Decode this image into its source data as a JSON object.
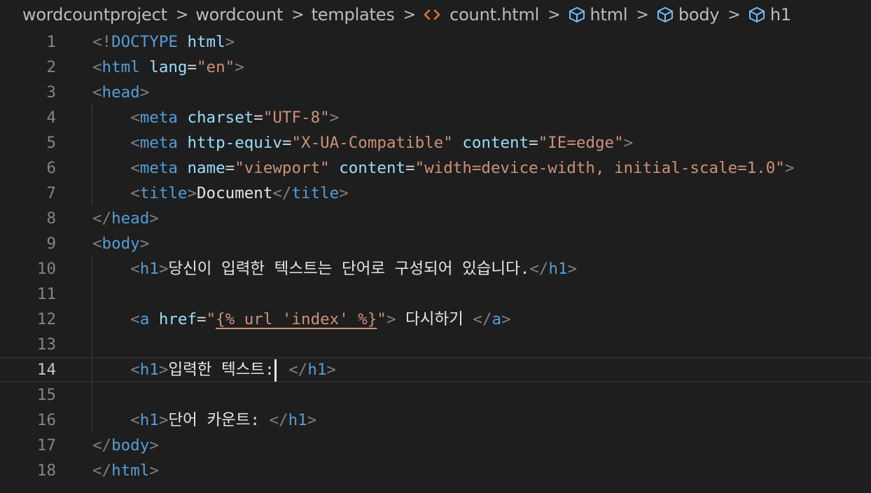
{
  "breadcrumb": {
    "items": [
      {
        "label": "wordcountproject",
        "icon": ""
      },
      {
        "label": "wordcount",
        "icon": ""
      },
      {
        "label": "templates",
        "icon": ""
      },
      {
        "label": "count.html",
        "icon": "html-file-icon"
      },
      {
        "label": "html",
        "icon": "element-cube-icon"
      },
      {
        "label": "body",
        "icon": "element-cube-icon"
      },
      {
        "label": "h1",
        "icon": "element-cube-icon"
      }
    ],
    "separator": ">"
  },
  "editor": {
    "current_line": 14,
    "colors": {
      "background": "#1e1e1e",
      "tag": "#569cd6",
      "attribute": "#9cdcfe",
      "string": "#ce9178",
      "punctuation": "#808080",
      "text": "#e6e6e6",
      "line_number": "#858585"
    },
    "lines": [
      {
        "number": "1",
        "tokens": [
          [
            "punc",
            "<!"
          ],
          [
            "tag",
            "DOCTYPE"
          ],
          [
            "txt",
            " "
          ],
          [
            "attr",
            "html"
          ],
          [
            "punc",
            ">"
          ]
        ]
      },
      {
        "number": "2",
        "tokens": [
          [
            "punc",
            "<"
          ],
          [
            "tag",
            "html"
          ],
          [
            "txt",
            " "
          ],
          [
            "attr",
            "lang"
          ],
          [
            "eq",
            "="
          ],
          [
            "str",
            "\"en\""
          ],
          [
            "punc",
            ">"
          ]
        ]
      },
      {
        "number": "3",
        "tokens": [
          [
            "punc",
            "<"
          ],
          [
            "tag",
            "head"
          ],
          [
            "punc",
            ">"
          ]
        ]
      },
      {
        "number": "4",
        "tokens": [
          [
            "txt",
            "    "
          ],
          [
            "punc",
            "<"
          ],
          [
            "tag",
            "meta"
          ],
          [
            "txt",
            " "
          ],
          [
            "attr",
            "charset"
          ],
          [
            "eq",
            "="
          ],
          [
            "str",
            "\"UTF-8\""
          ],
          [
            "punc",
            ">"
          ]
        ]
      },
      {
        "number": "5",
        "tokens": [
          [
            "txt",
            "    "
          ],
          [
            "punc",
            "<"
          ],
          [
            "tag",
            "meta"
          ],
          [
            "txt",
            " "
          ],
          [
            "attr",
            "http-equiv"
          ],
          [
            "eq",
            "="
          ],
          [
            "str",
            "\"X-UA-Compatible\""
          ],
          [
            "txt",
            " "
          ],
          [
            "attr",
            "content"
          ],
          [
            "eq",
            "="
          ],
          [
            "str",
            "\"IE=edge\""
          ],
          [
            "punc",
            ">"
          ]
        ]
      },
      {
        "number": "6",
        "tokens": [
          [
            "txt",
            "    "
          ],
          [
            "punc",
            "<"
          ],
          [
            "tag",
            "meta"
          ],
          [
            "txt",
            " "
          ],
          [
            "attr",
            "name"
          ],
          [
            "eq",
            "="
          ],
          [
            "str",
            "\"viewport\""
          ],
          [
            "txt",
            " "
          ],
          [
            "attr",
            "content"
          ],
          [
            "eq",
            "="
          ],
          [
            "str",
            "\"width=device-width, initial-scale=1.0\""
          ],
          [
            "punc",
            ">"
          ]
        ]
      },
      {
        "number": "7",
        "tokens": [
          [
            "txt",
            "    "
          ],
          [
            "punc",
            "<"
          ],
          [
            "tag",
            "title"
          ],
          [
            "punc",
            ">"
          ],
          [
            "txt",
            "Document"
          ],
          [
            "punc",
            "</"
          ],
          [
            "tag",
            "title"
          ],
          [
            "punc",
            ">"
          ]
        ]
      },
      {
        "number": "8",
        "tokens": [
          [
            "punc",
            "</"
          ],
          [
            "tag",
            "head"
          ],
          [
            "punc",
            ">"
          ]
        ]
      },
      {
        "number": "9",
        "tokens": [
          [
            "punc",
            "<"
          ],
          [
            "tag",
            "body"
          ],
          [
            "punc",
            ">"
          ]
        ]
      },
      {
        "number": "10",
        "tokens": [
          [
            "txt",
            "    "
          ],
          [
            "punc",
            "<"
          ],
          [
            "tag",
            "h1"
          ],
          [
            "punc",
            ">"
          ],
          [
            "txt",
            "당신이 입력한 텍스트는 단어로 구성되어 있습니다."
          ],
          [
            "punc",
            "</"
          ],
          [
            "tag",
            "h1"
          ],
          [
            "punc",
            ">"
          ]
        ]
      },
      {
        "number": "11",
        "tokens": []
      },
      {
        "number": "12",
        "tokens": [
          [
            "txt",
            "    "
          ],
          [
            "punc",
            "<"
          ],
          [
            "tag",
            "a"
          ],
          [
            "txt",
            " "
          ],
          [
            "attr",
            "href"
          ],
          [
            "eq",
            "="
          ],
          [
            "str",
            "\""
          ],
          [
            "tmpl",
            "{% url 'index' %}"
          ],
          [
            "str",
            "\""
          ],
          [
            "punc",
            ">"
          ],
          [
            "txt",
            " 다시하기 "
          ],
          [
            "punc",
            "</"
          ],
          [
            "tag",
            "a"
          ],
          [
            "punc",
            ">"
          ]
        ]
      },
      {
        "number": "13",
        "tokens": []
      },
      {
        "number": "14",
        "tokens": [
          [
            "txt",
            "    "
          ],
          [
            "punc",
            "<"
          ],
          [
            "tag",
            "h1"
          ],
          [
            "punc",
            ">"
          ],
          [
            "txt",
            "입력한 텍스트:"
          ],
          [
            "cursor",
            ""
          ],
          [
            "txt",
            " "
          ],
          [
            "punc",
            "</"
          ],
          [
            "tag",
            "h1"
          ],
          [
            "punc",
            ">"
          ]
        ]
      },
      {
        "number": "15",
        "tokens": []
      },
      {
        "number": "16",
        "tokens": [
          [
            "txt",
            "    "
          ],
          [
            "punc",
            "<"
          ],
          [
            "tag",
            "h1"
          ],
          [
            "punc",
            ">"
          ],
          [
            "txt",
            "단어 카운트: "
          ],
          [
            "punc",
            "</"
          ],
          [
            "tag",
            "h1"
          ],
          [
            "punc",
            ">"
          ]
        ]
      },
      {
        "number": "17",
        "tokens": [
          [
            "punc",
            "</"
          ],
          [
            "tag",
            "body"
          ],
          [
            "punc",
            ">"
          ]
        ]
      },
      {
        "number": "18",
        "tokens": [
          [
            "punc",
            "</"
          ],
          [
            "tag",
            "html"
          ],
          [
            "punc",
            ">"
          ]
        ]
      }
    ]
  }
}
